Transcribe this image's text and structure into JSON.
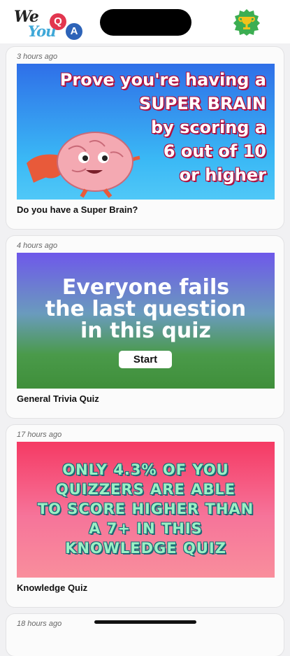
{
  "header": {
    "logo": {
      "we": "We",
      "you": "You",
      "q": "Q",
      "a": "A"
    },
    "trophy_icon": "trophy-icon"
  },
  "colors": {
    "brand_red": "#e2364f",
    "brand_blue": "#2d63b8",
    "trophy_green": "#3cae52"
  },
  "cards": [
    {
      "time": "3 hours ago",
      "title": "Do you have a Super Brain?",
      "thumb_lines": [
        "Prove you're having a",
        "SUPER BRAIN",
        "by scoring a",
        "6 out of 10",
        "or higher"
      ]
    },
    {
      "time": "4 hours ago",
      "title": "General Trivia Quiz",
      "thumb_lines": [
        "Everyone fails",
        "the last question",
        "in this quiz"
      ],
      "start_label": "Start"
    },
    {
      "time": "17 hours ago",
      "title": "Knowledge Quiz",
      "thumb_lines": [
        "ONLY 4.3% OF YOU",
        "QUIZZERS ARE ABLE",
        "TO SCORE HIGHER THAN",
        "A 7+ IN THIS",
        "KNOWLEDGE QUIZ"
      ]
    },
    {
      "time": "18 hours ago"
    }
  ]
}
